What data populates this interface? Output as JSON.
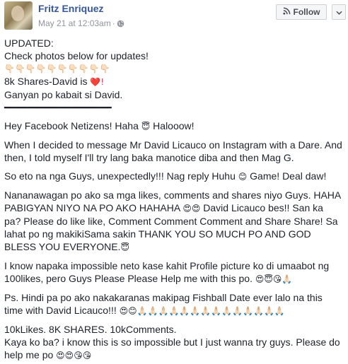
{
  "post": {
    "author": "Fritz Enriquez",
    "timestamp": "May 21 at 12:03am",
    "separator": "·",
    "follow_label": "Follow"
  },
  "body": {
    "l1": "UPDATED:",
    "l2": "Check photos below for updates!",
    "l3": "👇🏻👇🏻👇🏻👇🏻👇🏻👇🏻👇🏻👇🏻👇🏻👇🏻",
    "l4a": "8k Shares-David is ",
    "l4b": "❤️!",
    "l5": "Ganyan po kabait si David.",
    "l6": "━━━━━━━━━━━━━━━━━━",
    "p1a": "Hey Facebook Netizens! Haha ",
    "p1e": "😇",
    "p1b": " Halooow!",
    "p2": "When I decided to message Mr David Licauco on Instagram with a Dare. And then, I told myself I'll try lang baka manotice diba and then Mag G.",
    "p3a": "So eto na nga Guys, unexpectedly!!! Nag reply Huhu ",
    "p3e": "😊",
    "p3b": " Game! Deal daw!",
    "p4a": "Nananawagan po ako sa mga likes, comments and shares niyo Guys. HAHA PABIGYAN NIYO NA PO AKO HAHAHA ",
    "p4e": "😍😍",
    "p4b": " David Licauco bes!! San ka pa? Please do like like, Comment Comment Comment and Share Share! Sa lahat po ng makikiSama sakin THANK YOU SO MUCH PO AND GOD BLESS YOU EVERYONE.",
    "p4e2": "😇",
    "p5a": "I know napaka impossible neto kase kahit Profile picture ko di umaabot ng 100likes, pero Guys Please Please Help me with this po. ",
    "p5e": "😍😇😘🙏🏻",
    "p6a": "Ps. Hindi pa po ako nakakaranas makipag Fishball Date ever lalo na this time with David Licauco!!! ",
    "p6e": "😍😊🙏🏻🙏🏻🙏🏻🙏🏻🙏🏻🙏🏻🙏🏻🙏🏻🙏🏻🙏🏻🙏🏻🙏🏻🙏🏻🙏🏻",
    "p7a": "10kLikes. 8K SHARES. 10kComments.",
    "p7b": "Kaya ko ba? i know this is so impossible but I just wanna try guys. Please do help me po ",
    "p7e": "😍😍😘😘"
  },
  "colors": {
    "author": "#365899",
    "meta": "#90949c",
    "text": "#1d2129",
    "button_bg": "#f5f6f7",
    "button_border": "#ced0d4"
  },
  "icons": [
    "globe-icon",
    "rss-icon",
    "chevron-down-icon"
  ]
}
